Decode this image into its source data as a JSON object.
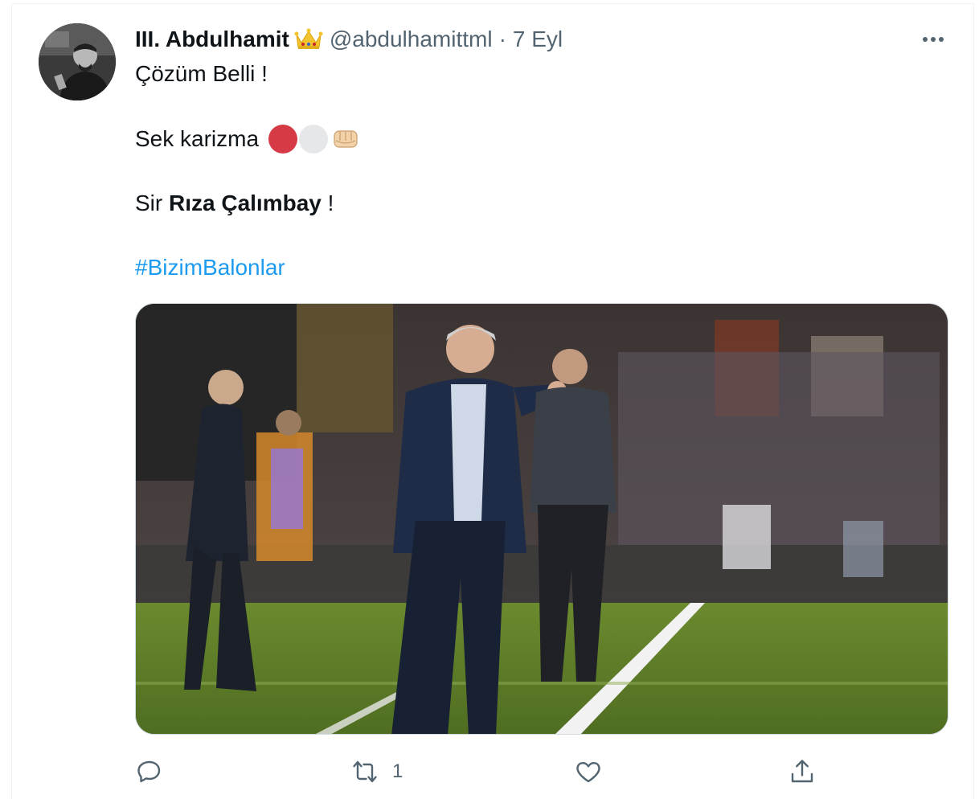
{
  "tweet": {
    "author_name": "III. Abdulhamit",
    "author_emoji": "👑",
    "handle": "@abdulhamittml",
    "separator": "·",
    "time": "7 Eyl",
    "lines": {
      "line1": "Çözüm Belli !",
      "line2": "Sek karizma",
      "line3_prefix": "Sir ",
      "line3_bold": "Rıza Çalımbay",
      "line3_suffix": " !",
      "hashtag": "#BizimBalonlar"
    },
    "emojis": {
      "red_circle": "#d63a47",
      "white_circle": "#e6e7e9",
      "fist": "👊"
    }
  },
  "actions": {
    "reply_icon": "reply-icon",
    "retweet_icon": "retweet-icon",
    "retweet_count": "1",
    "like_icon": "heart-icon",
    "share_icon": "share-icon"
  },
  "colors": {
    "text_primary": "#0f1419",
    "text_secondary": "#536471",
    "link": "#1d9bf0",
    "border": "#cfd9de"
  }
}
